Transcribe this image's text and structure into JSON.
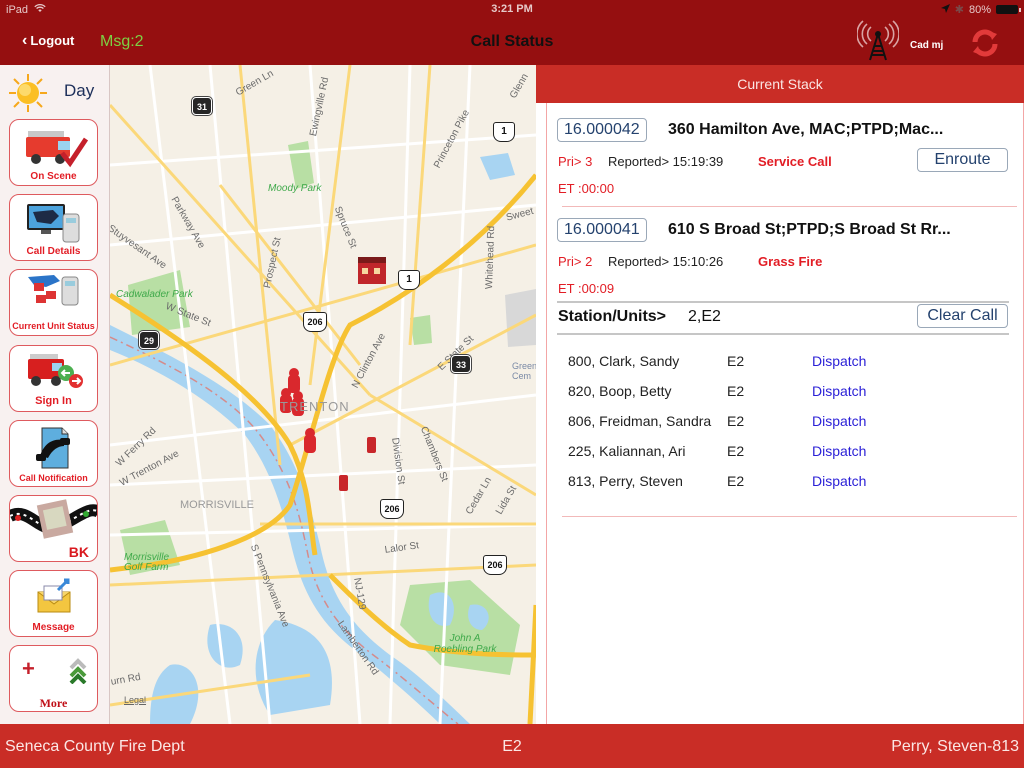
{
  "status_bar": {
    "device": "iPad",
    "time": "3:21 PM",
    "battery": "80%"
  },
  "nav": {
    "back_label": "Logout",
    "messages": "Msg:2",
    "title": "Call Status",
    "user_tag": "Cad mj",
    "icons": [
      "radio-tower-icon",
      "refresh-icon"
    ]
  },
  "sidebar": {
    "mode_label": "Day",
    "buttons": [
      {
        "label": "On Scene",
        "icon": "fire-truck-check-icon"
      },
      {
        "label": "Call Details",
        "icon": "monitor-phone-icon"
      },
      {
        "label": "Current Unit Status",
        "icon": "unit-status-icon"
      },
      {
        "label": "Sign In",
        "icon": "truck-signin-icon"
      },
      {
        "label": "Call Notification",
        "icon": "phone-notification-icon"
      },
      {
        "label": "BK",
        "icon": "film-strip-icon"
      },
      {
        "label": "Message",
        "icon": "envelope-icon"
      },
      {
        "label": "More",
        "icon": "more-plus-chevrons-icon"
      }
    ]
  },
  "map": {
    "legal_label": "Legal",
    "labels": {
      "green_ln": "Green Ln",
      "ewingville": "Ewingville Rd",
      "princeton_pike": "Princeton Pike",
      "glenn": "Glenn",
      "moody_park": "Moody Park",
      "parkway": "Parkway Ave",
      "spruce": "Spruce St",
      "sweet": "Sweet",
      "stuyvesant": "Stuyvesant Ave",
      "prospect": "Prospect St",
      "whitehead": "Whitehead Rd",
      "cadwalader": "Cadwalader Park",
      "w_state": "W State St",
      "n_clinton": "N Clinton Ave",
      "e_state": "E State St",
      "greenwood": "Green Cem",
      "trenton": "TRENTON",
      "ferry": "W Ferry Rd",
      "w_trenton": "W Trenton Ave",
      "division": "Division St",
      "chambers": "Chambers St",
      "morrisville": "MORRISVILLE",
      "cedar": "Cedar Ln",
      "lida": "Lida St",
      "lalor": "Lalor St",
      "morrisville_golf": "Morrisville Golf Farm",
      "s_penn": "S Pennsylvania Ave",
      "nj129": "NJ-129",
      "lamberton": "Lamberton Rd",
      "roebling": "John A Roebling Park",
      "urn_rd": "urn Rd"
    },
    "route_shields": {
      "r31": "31",
      "r1a": "1",
      "r1b": "1",
      "r206a": "206",
      "r29": "29",
      "r33": "33",
      "r206b": "206",
      "r206c": "206"
    }
  },
  "stack": {
    "header": "Current Stack",
    "calls": [
      {
        "id": "16.000042",
        "address": "360 Hamilton Ave, MAC;PTPD;Mac...",
        "priority": "Pri> 3",
        "reported": "Reported> 15:19:39",
        "type": "Service Call",
        "elapsed": "ET :00:00",
        "action": "Enroute"
      },
      {
        "id": "16.000041",
        "address": "610 S Broad St;PTPD;S Broad St Rr...",
        "priority": "Pri> 2",
        "reported": "Reported> 15:10:26",
        "type": "Grass Fire",
        "elapsed": "ET :00:09"
      }
    ],
    "station_label": "Station/Units>",
    "station_value": "2,E2",
    "clear_call": "Clear Call",
    "units": [
      {
        "name": "800, Clark, Sandy",
        "unit": "E2",
        "action": "Dispatch"
      },
      {
        "name": "820, Boop, Betty",
        "unit": "E2",
        "action": "Dispatch"
      },
      {
        "name": "806, Freidman, Sandra",
        "unit": "E2",
        "action": "Dispatch"
      },
      {
        "name": "225, Kaliannan, Ari",
        "unit": "E2",
        "action": "Dispatch"
      },
      {
        "name": "813, Perry, Steven",
        "unit": "E2",
        "action": "Dispatch"
      }
    ]
  },
  "footer": {
    "department": "Seneca County Fire Dept",
    "unit": "E2",
    "user": "Perry, Steven-813"
  },
  "colors": {
    "topbar": "#950f10",
    "accent_red": "#c92d26",
    "alert_red": "#e21d25",
    "link_blue": "#2a1fd6",
    "msg_green": "#7dd043"
  }
}
